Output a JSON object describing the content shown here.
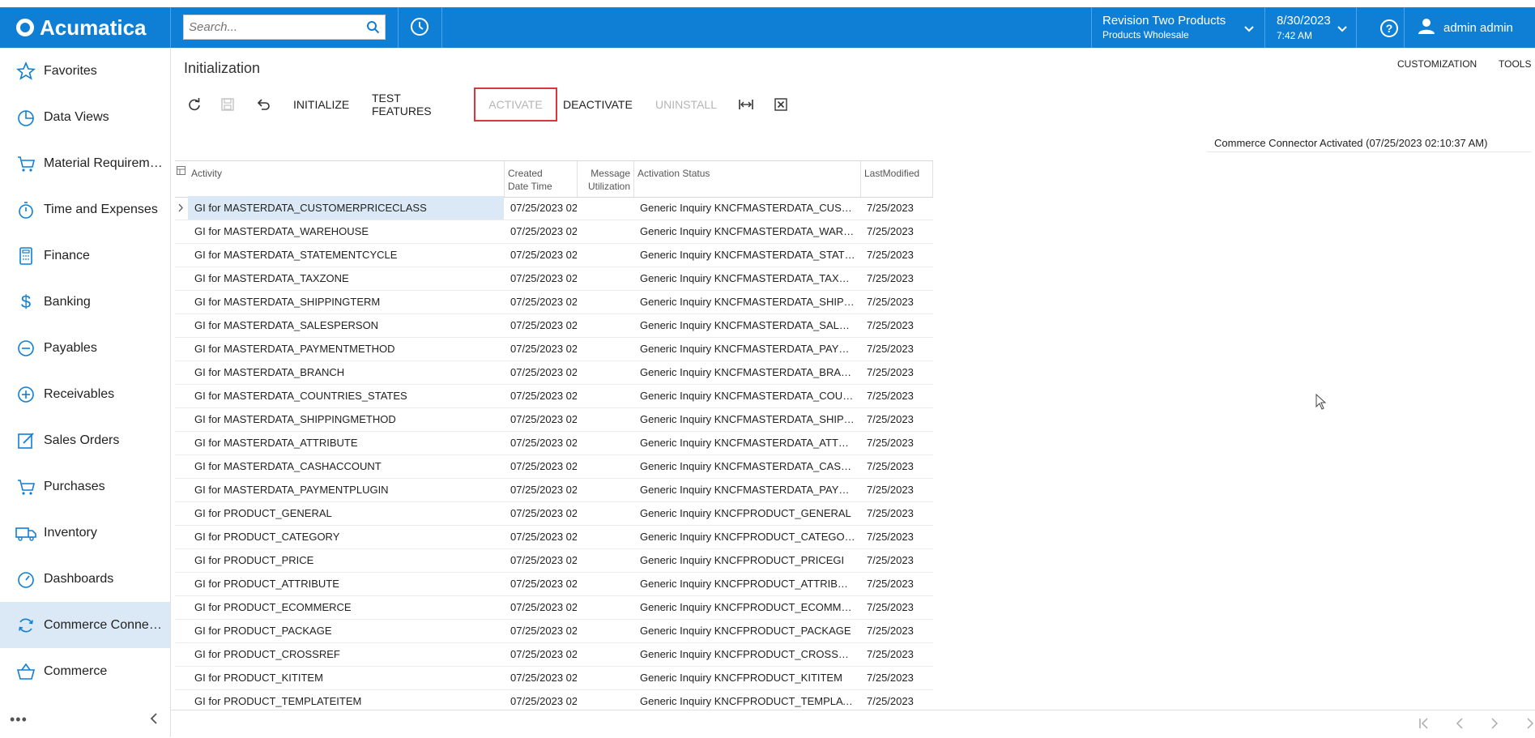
{
  "app": {
    "brand": "Acumatica"
  },
  "header": {
    "search_placeholder": "Search...",
    "company_line1": "Revision Two Products",
    "company_line2": "Products Wholesale",
    "date": "8/30/2023",
    "time": "7:42 AM",
    "user": "admin admin"
  },
  "sidebar": {
    "items": [
      {
        "label": "Favorites",
        "icon": "star-icon"
      },
      {
        "label": "Data Views",
        "icon": "pie-chart-icon"
      },
      {
        "label": "Material Requirements Planning",
        "icon": "cart-icon"
      },
      {
        "label": "Time and Expenses",
        "icon": "stopwatch-icon"
      },
      {
        "label": "Finance",
        "icon": "calculator-icon"
      },
      {
        "label": "Banking",
        "icon": "dollar-icon"
      },
      {
        "label": "Payables",
        "icon": "minus-circle-icon"
      },
      {
        "label": "Receivables",
        "icon": "plus-circle-icon"
      },
      {
        "label": "Sales Orders",
        "icon": "edit-icon"
      },
      {
        "label": "Purchases",
        "icon": "cart-icon"
      },
      {
        "label": "Inventory",
        "icon": "truck-icon"
      },
      {
        "label": "Dashboards",
        "icon": "gauge-icon"
      },
      {
        "label": "Commerce Connector",
        "icon": "sync-icon"
      },
      {
        "label": "Commerce",
        "icon": "basket-icon"
      }
    ],
    "more": "•••"
  },
  "page": {
    "title": "Initialization",
    "customization": "CUSTOMIZATION",
    "tools": "TOOLS",
    "status_message": "Commerce Connector Activated (07/25/2023 02:10:37 AM)"
  },
  "toolbar": {
    "initialize": "INITIALIZE",
    "test_features": "TEST FEATURES",
    "activate": "ACTIVATE",
    "deactivate": "DEACTIVATE",
    "uninstall": "UNINSTALL"
  },
  "grid": {
    "headers": {
      "activity": "Activity",
      "created_1": "Created",
      "created_2": "Date Time",
      "message_1": "Message",
      "message_2": "Utilization",
      "status": "Activation Status",
      "modified": "LastModified"
    },
    "rows": [
      {
        "activity": "GI for MASTERDATA_CUSTOMERPRICECLASS",
        "created": "07/25/2023 02",
        "status": "Generic Inquiry KNCFMASTERDATA_CUSTOMERPRICECLASS",
        "modified": "7/25/2023"
      },
      {
        "activity": "GI for MASTERDATA_WAREHOUSE",
        "created": "07/25/2023 02",
        "status": "Generic Inquiry KNCFMASTERDATA_WAREHOUSE",
        "modified": "7/25/2023"
      },
      {
        "activity": "GI for MASTERDATA_STATEMENTCYCLE",
        "created": "07/25/2023 02",
        "status": "Generic Inquiry KNCFMASTERDATA_STATEMENTCYCLE",
        "modified": "7/25/2023"
      },
      {
        "activity": "GI for MASTERDATA_TAXZONE",
        "created": "07/25/2023 02",
        "status": "Generic Inquiry KNCFMASTERDATA_TAXZONE",
        "modified": "7/25/2023"
      },
      {
        "activity": "GI for MASTERDATA_SHIPPINGTERM",
        "created": "07/25/2023 02",
        "status": "Generic Inquiry KNCFMASTERDATA_SHIPPINGTERM",
        "modified": "7/25/2023"
      },
      {
        "activity": "GI for MASTERDATA_SALESPERSON",
        "created": "07/25/2023 02",
        "status": "Generic Inquiry KNCFMASTERDATA_SALESPERSON",
        "modified": "7/25/2023"
      },
      {
        "activity": "GI for MASTERDATA_PAYMENTMETHOD",
        "created": "07/25/2023 02",
        "status": "Generic Inquiry KNCFMASTERDATA_PAYMENTMETHOD",
        "modified": "7/25/2023"
      },
      {
        "activity": "GI for MASTERDATA_BRANCH",
        "created": "07/25/2023 02",
        "status": "Generic Inquiry KNCFMASTERDATA_BRANCH",
        "modified": "7/25/2023"
      },
      {
        "activity": "GI for MASTERDATA_COUNTRIES_STATES",
        "created": "07/25/2023 02",
        "status": "Generic Inquiry KNCFMASTERDATA_COUNTRIES_STATES",
        "modified": "7/25/2023"
      },
      {
        "activity": "GI for MASTERDATA_SHIPPINGMETHOD",
        "created": "07/25/2023 02",
        "status": "Generic Inquiry KNCFMASTERDATA_SHIPPINGMETHOD",
        "modified": "7/25/2023"
      },
      {
        "activity": "GI for MASTERDATA_ATTRIBUTE",
        "created": "07/25/2023 02",
        "status": "Generic Inquiry KNCFMASTERDATA_ATTRIBUTE",
        "modified": "7/25/2023"
      },
      {
        "activity": "GI for MASTERDATA_CASHACCOUNT",
        "created": "07/25/2023 02",
        "status": "Generic Inquiry KNCFMASTERDATA_CASHACCOUNT",
        "modified": "7/25/2023"
      },
      {
        "activity": "GI for MASTERDATA_PAYMENTPLUGIN",
        "created": "07/25/2023 02",
        "status": "Generic Inquiry KNCFMASTERDATA_PAYMENTPLUGIN",
        "modified": "7/25/2023"
      },
      {
        "activity": "GI for PRODUCT_GENERAL",
        "created": "07/25/2023 02",
        "status": "Generic Inquiry KNCFPRODUCT_GENERAL",
        "modified": "7/25/2023"
      },
      {
        "activity": "GI for PRODUCT_CATEGORY",
        "created": "07/25/2023 02",
        "status": "Generic Inquiry KNCFPRODUCT_CATEGORY",
        "modified": "7/25/2023"
      },
      {
        "activity": "GI for PRODUCT_PRICE",
        "created": "07/25/2023 02",
        "status": "Generic Inquiry KNCFPRODUCT_PRICEGI",
        "modified": "7/25/2023"
      },
      {
        "activity": "GI for PRODUCT_ATTRIBUTE",
        "created": "07/25/2023 02",
        "status": "Generic Inquiry KNCFPRODUCT_ATTRIBUTE",
        "modified": "7/25/2023"
      },
      {
        "activity": "GI for PRODUCT_ECOMMERCE",
        "created": "07/25/2023 02",
        "status": "Generic Inquiry KNCFPRODUCT_ECOMMERCE",
        "modified": "7/25/2023"
      },
      {
        "activity": "GI for PRODUCT_PACKAGE",
        "created": "07/25/2023 02",
        "status": "Generic Inquiry KNCFPRODUCT_PACKAGE",
        "modified": "7/25/2023"
      },
      {
        "activity": "GI for PRODUCT_CROSSREF",
        "created": "07/25/2023 02",
        "status": "Generic Inquiry KNCFPRODUCT_CROSSREF",
        "modified": "7/25/2023"
      },
      {
        "activity": "GI for PRODUCT_KITITEM",
        "created": "07/25/2023 02",
        "status": "Generic Inquiry KNCFPRODUCT_KITITEM",
        "modified": "7/25/2023"
      },
      {
        "activity": "GI for PRODUCT_TEMPLATEITEM",
        "created": "07/25/2023 02",
        "status": "Generic Inquiry KNCFPRODUCT_TEMPLATEITEM",
        "modified": "7/25/2023"
      }
    ]
  }
}
